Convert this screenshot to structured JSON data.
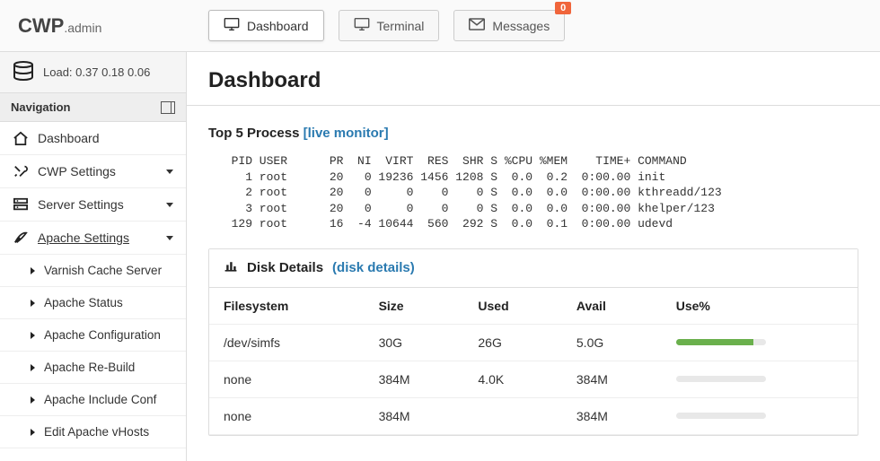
{
  "logo": {
    "main": "CWP",
    "sub": ".admin"
  },
  "tabs": [
    {
      "key": "dashboard",
      "label": "Dashboard",
      "active": true
    },
    {
      "key": "terminal",
      "label": "Terminal"
    },
    {
      "key": "messages",
      "label": "Messages",
      "badge": "0"
    }
  ],
  "load": {
    "label": "Load:",
    "vals": "0.37  0.18  0.06"
  },
  "navigation_label": "Navigation",
  "nav": [
    {
      "key": "dashboard",
      "label": "Dashboard"
    },
    {
      "key": "cwp-settings",
      "label": "CWP Settings",
      "caret": true
    },
    {
      "key": "server-settings",
      "label": "Server Settings",
      "caret": true
    },
    {
      "key": "apache-settings",
      "label": "Apache Settings",
      "caret": true,
      "active": true
    }
  ],
  "apache_sub": [
    "Varnish Cache Server",
    "Apache Status",
    "Apache Configuration",
    "Apache Re-Build",
    "Apache Include Conf",
    "Edit Apache vHosts"
  ],
  "page_title": "Dashboard",
  "top5": {
    "title": "Top 5 Process",
    "link": "[live monitor]",
    "header": "  PID USER      PR  NI  VIRT  RES  SHR S %CPU %MEM    TIME+ COMMAND",
    "rows": [
      "    1 root      20   0 19236 1456 1208 S  0.0  0.2  0:00.00 init",
      "    2 root      20   0     0    0    0 S  0.0  0.0  0:00.00 kthreadd/123",
      "    3 root      20   0     0    0    0 S  0.0  0.0  0:00.00 khelper/123",
      "  129 root      16  -4 10644  560  292 S  0.0  0.1  0:00.00 udevd"
    ]
  },
  "disk": {
    "title": "Disk Details",
    "link": "(disk details)",
    "cols": [
      "Filesystem",
      "Size",
      "Used",
      "Avail",
      "Use%"
    ],
    "rows": [
      {
        "fs": "/dev/simfs",
        "size": "30G",
        "used": "26G",
        "avail": "5.0G",
        "use": 86
      },
      {
        "fs": "none",
        "size": "384M",
        "used": "4.0K",
        "avail": "384M",
        "use": 0
      },
      {
        "fs": "none",
        "size": "384M",
        "used": "",
        "avail": "384M",
        "use": 0
      }
    ]
  }
}
